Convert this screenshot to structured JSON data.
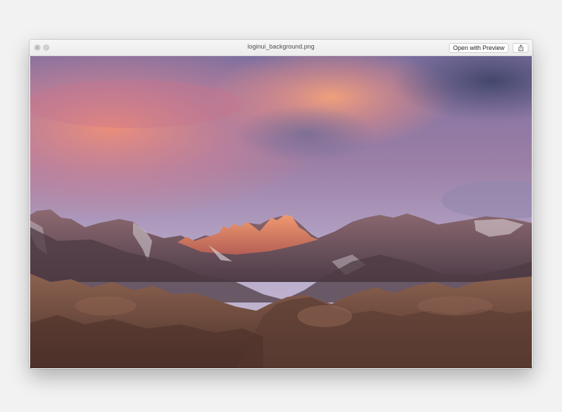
{
  "window": {
    "title": "loginui_background.png",
    "buttons": {
      "open_with_preview": "Open with Preview"
    },
    "icons": {
      "close": "close-icon",
      "fullscreen": "fullscreen-icon",
      "share": "share-icon"
    }
  },
  "colors": {
    "desktop_background": "#f2f2f2",
    "titlebar": "#ececec",
    "sky_top": "#7b6f9f",
    "sky_glow": "#e98b72",
    "sky_right": "#b8b2d3",
    "mountain_dark": "#5d4a55",
    "foreground_rock": "#6a4a3c"
  }
}
